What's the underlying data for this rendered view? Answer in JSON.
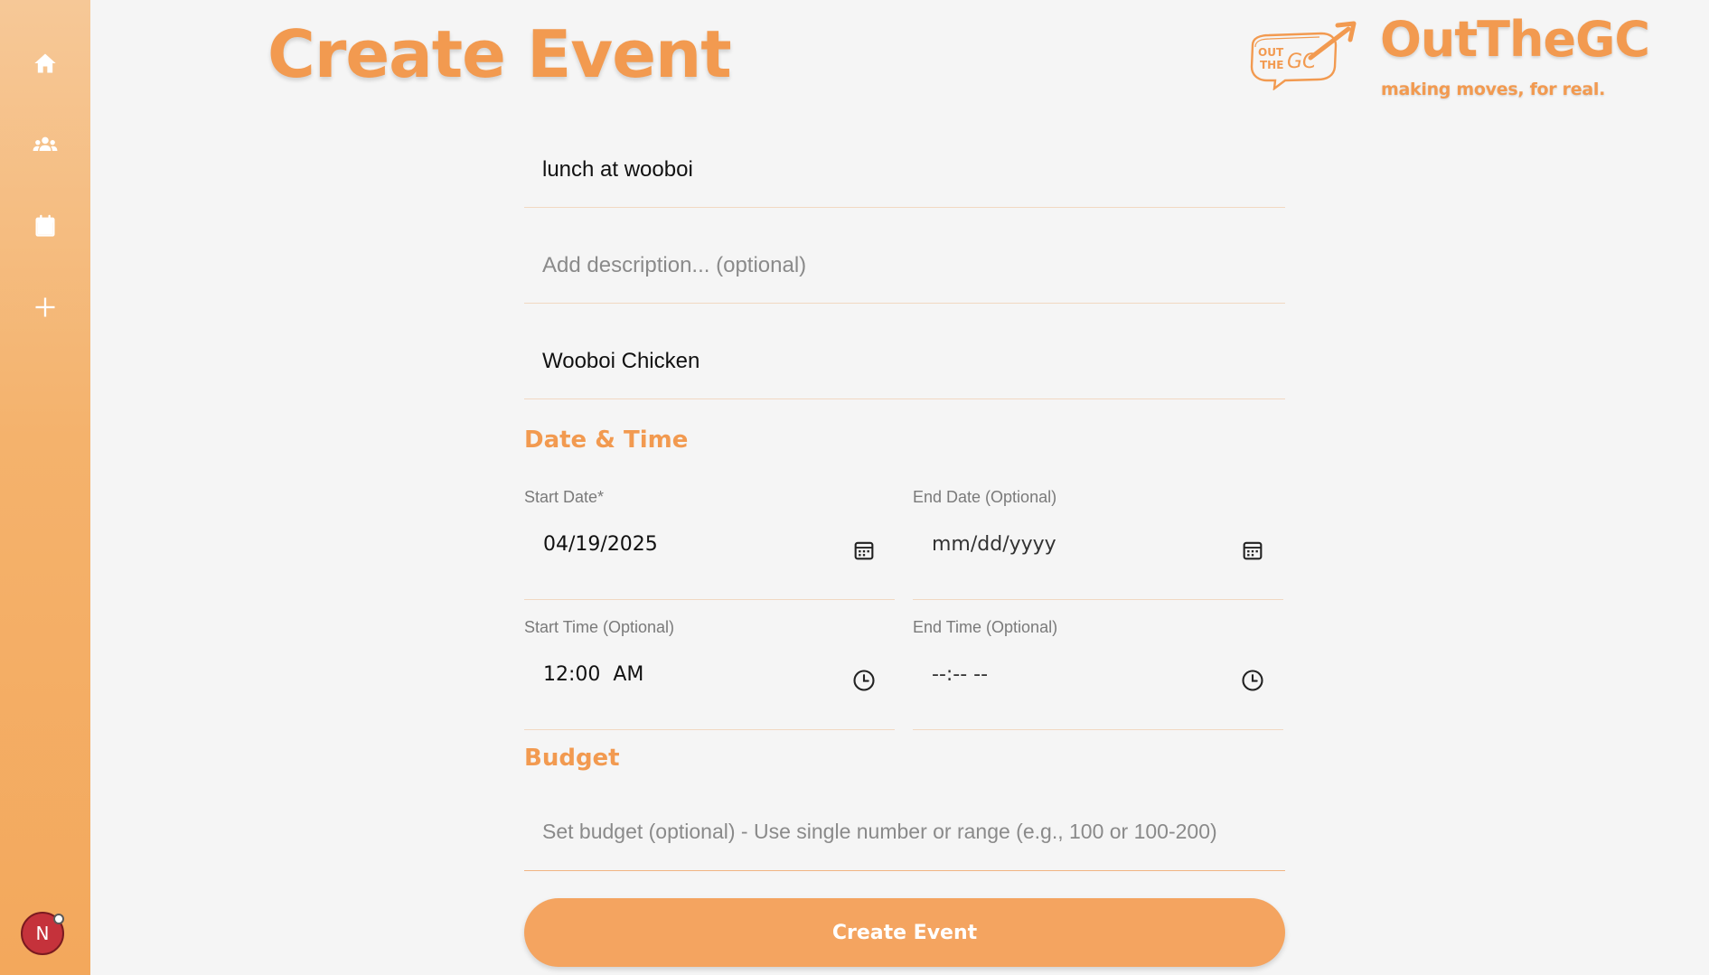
{
  "sidebar": {
    "items": [
      {
        "icon": "home-icon"
      },
      {
        "icon": "groups-icon"
      },
      {
        "icon": "calendar-icon"
      },
      {
        "icon": "add-icon"
      }
    ],
    "avatar_initial": "N"
  },
  "header": {
    "title": "Create Event",
    "brand_name": "OutTheGC",
    "tagline": "making moves, for real.",
    "logo_text": "OUT THE GC"
  },
  "form": {
    "event_name": {
      "value": "lunch at wooboi",
      "placeholder": ""
    },
    "description": {
      "value": "",
      "placeholder": "Add description... (optional)"
    },
    "location": {
      "value": "Wooboi Chicken",
      "placeholder": ""
    },
    "date_time_section": "Date & Time",
    "start_date": {
      "label": "Start Date*",
      "value": "04/19/2025"
    },
    "end_date": {
      "label": "End Date (Optional)",
      "value": "mm/dd/yyyy"
    },
    "start_time": {
      "label": "Start Time (Optional)",
      "value": "12:00  AM"
    },
    "end_time": {
      "label": "End Time (Optional)",
      "value": "--:-- --"
    },
    "budget_section": "Budget",
    "budget": {
      "value": "",
      "placeholder": "Set budget (optional) - Use single number or range (e.g., 100 or 100-200)"
    },
    "submit_label": "Create Event"
  },
  "colors": {
    "accent": "#f29a50",
    "button": "#f4a460",
    "sidebar_top": "#f6c897",
    "sidebar_bottom": "#f3a85c",
    "avatar": "#c5323b"
  }
}
